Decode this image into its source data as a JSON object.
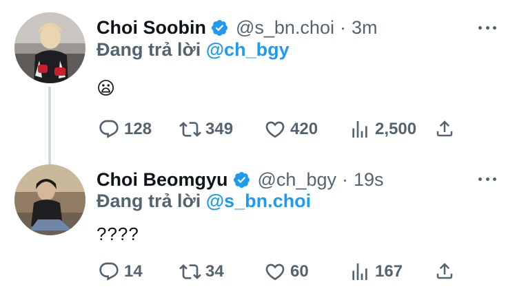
{
  "tweets": [
    {
      "name": "Choi Soobin",
      "handle": "@s_bn.choi",
      "separator": "·",
      "time": "3m",
      "reply_prefix": "Đang trả lời",
      "reply_to": "@ch_bgy",
      "text": "😦",
      "replies": "128",
      "retweets": "349",
      "likes": "420",
      "views": "2,500"
    },
    {
      "name": "Choi Beomgyu",
      "handle": "@ch_bgy",
      "separator": "·",
      "time": "19s",
      "reply_prefix": "Đang trả lời",
      "reply_to": "@s_bn.choi",
      "text": "????",
      "replies": "14",
      "retweets": "34",
      "likes": "60",
      "views": "167"
    }
  ],
  "icons": {
    "verified": "verified-badge-icon",
    "more": "more-icon",
    "reply": "reply-icon",
    "retweet": "retweet-icon",
    "like": "like-icon",
    "views": "views-icon",
    "share": "share-icon"
  },
  "colors": {
    "accent": "#1d9bf0",
    "muted": "#536471",
    "text": "#0f1419",
    "thread_line": "#cfd9de"
  }
}
